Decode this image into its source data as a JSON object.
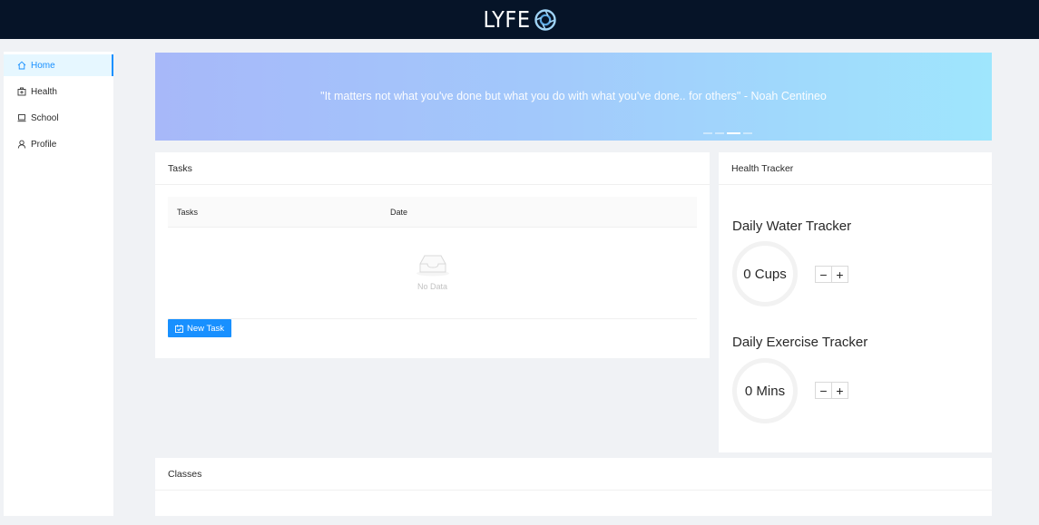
{
  "app": {
    "logo_text": "LYFE"
  },
  "sidebar": {
    "items": [
      {
        "label": "Home",
        "icon": "home-icon",
        "active": true
      },
      {
        "label": "Health",
        "icon": "medkit-icon",
        "active": false
      },
      {
        "label": "School",
        "icon": "laptop-icon",
        "active": false
      },
      {
        "label": "Profile",
        "icon": "user-icon",
        "active": false
      }
    ]
  },
  "banner": {
    "quote": "\"It matters not what you've done but what you do with what you've done.. for others\" - Noah Centineo",
    "slide_count": 4,
    "active_slide": 3
  },
  "tasks": {
    "title": "Tasks",
    "columns": [
      "Tasks",
      "Date"
    ],
    "empty_text": "No Data",
    "new_task_label": "New Task"
  },
  "health": {
    "title": "Health Tracker",
    "water": {
      "title": "Daily Water Tracker",
      "value": "0 Cups"
    },
    "exercise": {
      "title": "Daily Exercise Tracker",
      "value": "0 Mins"
    },
    "minus_label": "−",
    "plus_label": "+"
  },
  "classes": {
    "title": "Classes"
  },
  "colors": {
    "topbar": "#061428",
    "accent": "#1890ff",
    "background": "#f0f2f5"
  }
}
